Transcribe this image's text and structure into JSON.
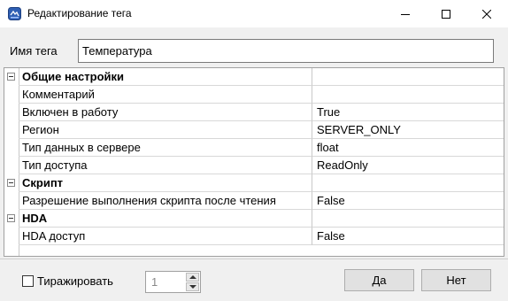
{
  "window": {
    "title": "Редактирование тега",
    "icon": "app-icon"
  },
  "tag_name": {
    "label": "Имя тега",
    "value": "Температура"
  },
  "properties": [
    {
      "type": "category",
      "name": "Общие настройки",
      "value": ""
    },
    {
      "type": "property",
      "name": "Комментарий",
      "value": ""
    },
    {
      "type": "property",
      "name": "Включен в работу",
      "value": "True"
    },
    {
      "type": "property",
      "name": "Регион",
      "value": "SERVER_ONLY"
    },
    {
      "type": "property",
      "name": "Тип данных в сервере",
      "value": "float"
    },
    {
      "type": "property",
      "name": "Тип доступа",
      "value": "ReadOnly"
    },
    {
      "type": "category",
      "name": "Скрипт",
      "value": ""
    },
    {
      "type": "property",
      "name": "Разрешение выполнения скрипта после чтения",
      "value": "False"
    },
    {
      "type": "category",
      "name": "HDA",
      "value": ""
    },
    {
      "type": "property",
      "name": "HDA доступ",
      "value": "False"
    }
  ],
  "footer": {
    "replicate_label": "Тиражировать",
    "replicate_checked": false,
    "count_value": "1",
    "yes_label": "Да",
    "no_label": "Нет"
  }
}
